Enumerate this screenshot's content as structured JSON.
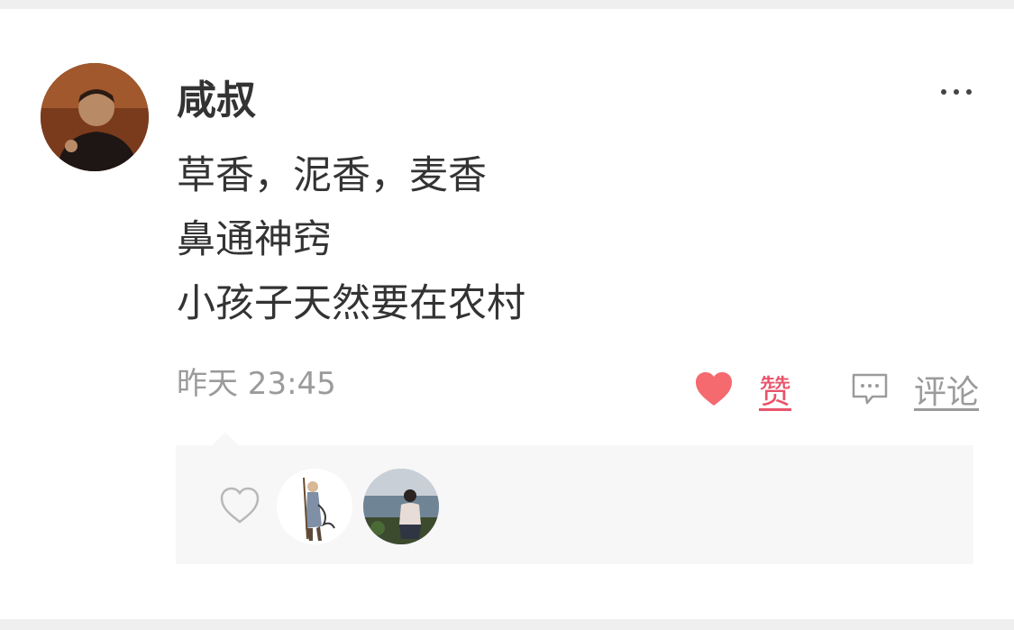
{
  "post": {
    "username": "咸叔",
    "content_lines": [
      "草香，泥香，麦香",
      "鼻通神窍",
      "小孩子天然要在农村"
    ],
    "time": "昨天 23:45"
  },
  "actions": {
    "like_label": "赞",
    "comment_label": "评论",
    "like_color": "#e9546b",
    "muted_color": "#9b9b9b"
  },
  "icons": {
    "more": "more-icon",
    "like": "heart-filled-icon",
    "comment": "comment-bubble-icon",
    "likes_list": "heart-outline-icon"
  },
  "likers": [
    "liker-avatar-1",
    "liker-avatar-2"
  ]
}
